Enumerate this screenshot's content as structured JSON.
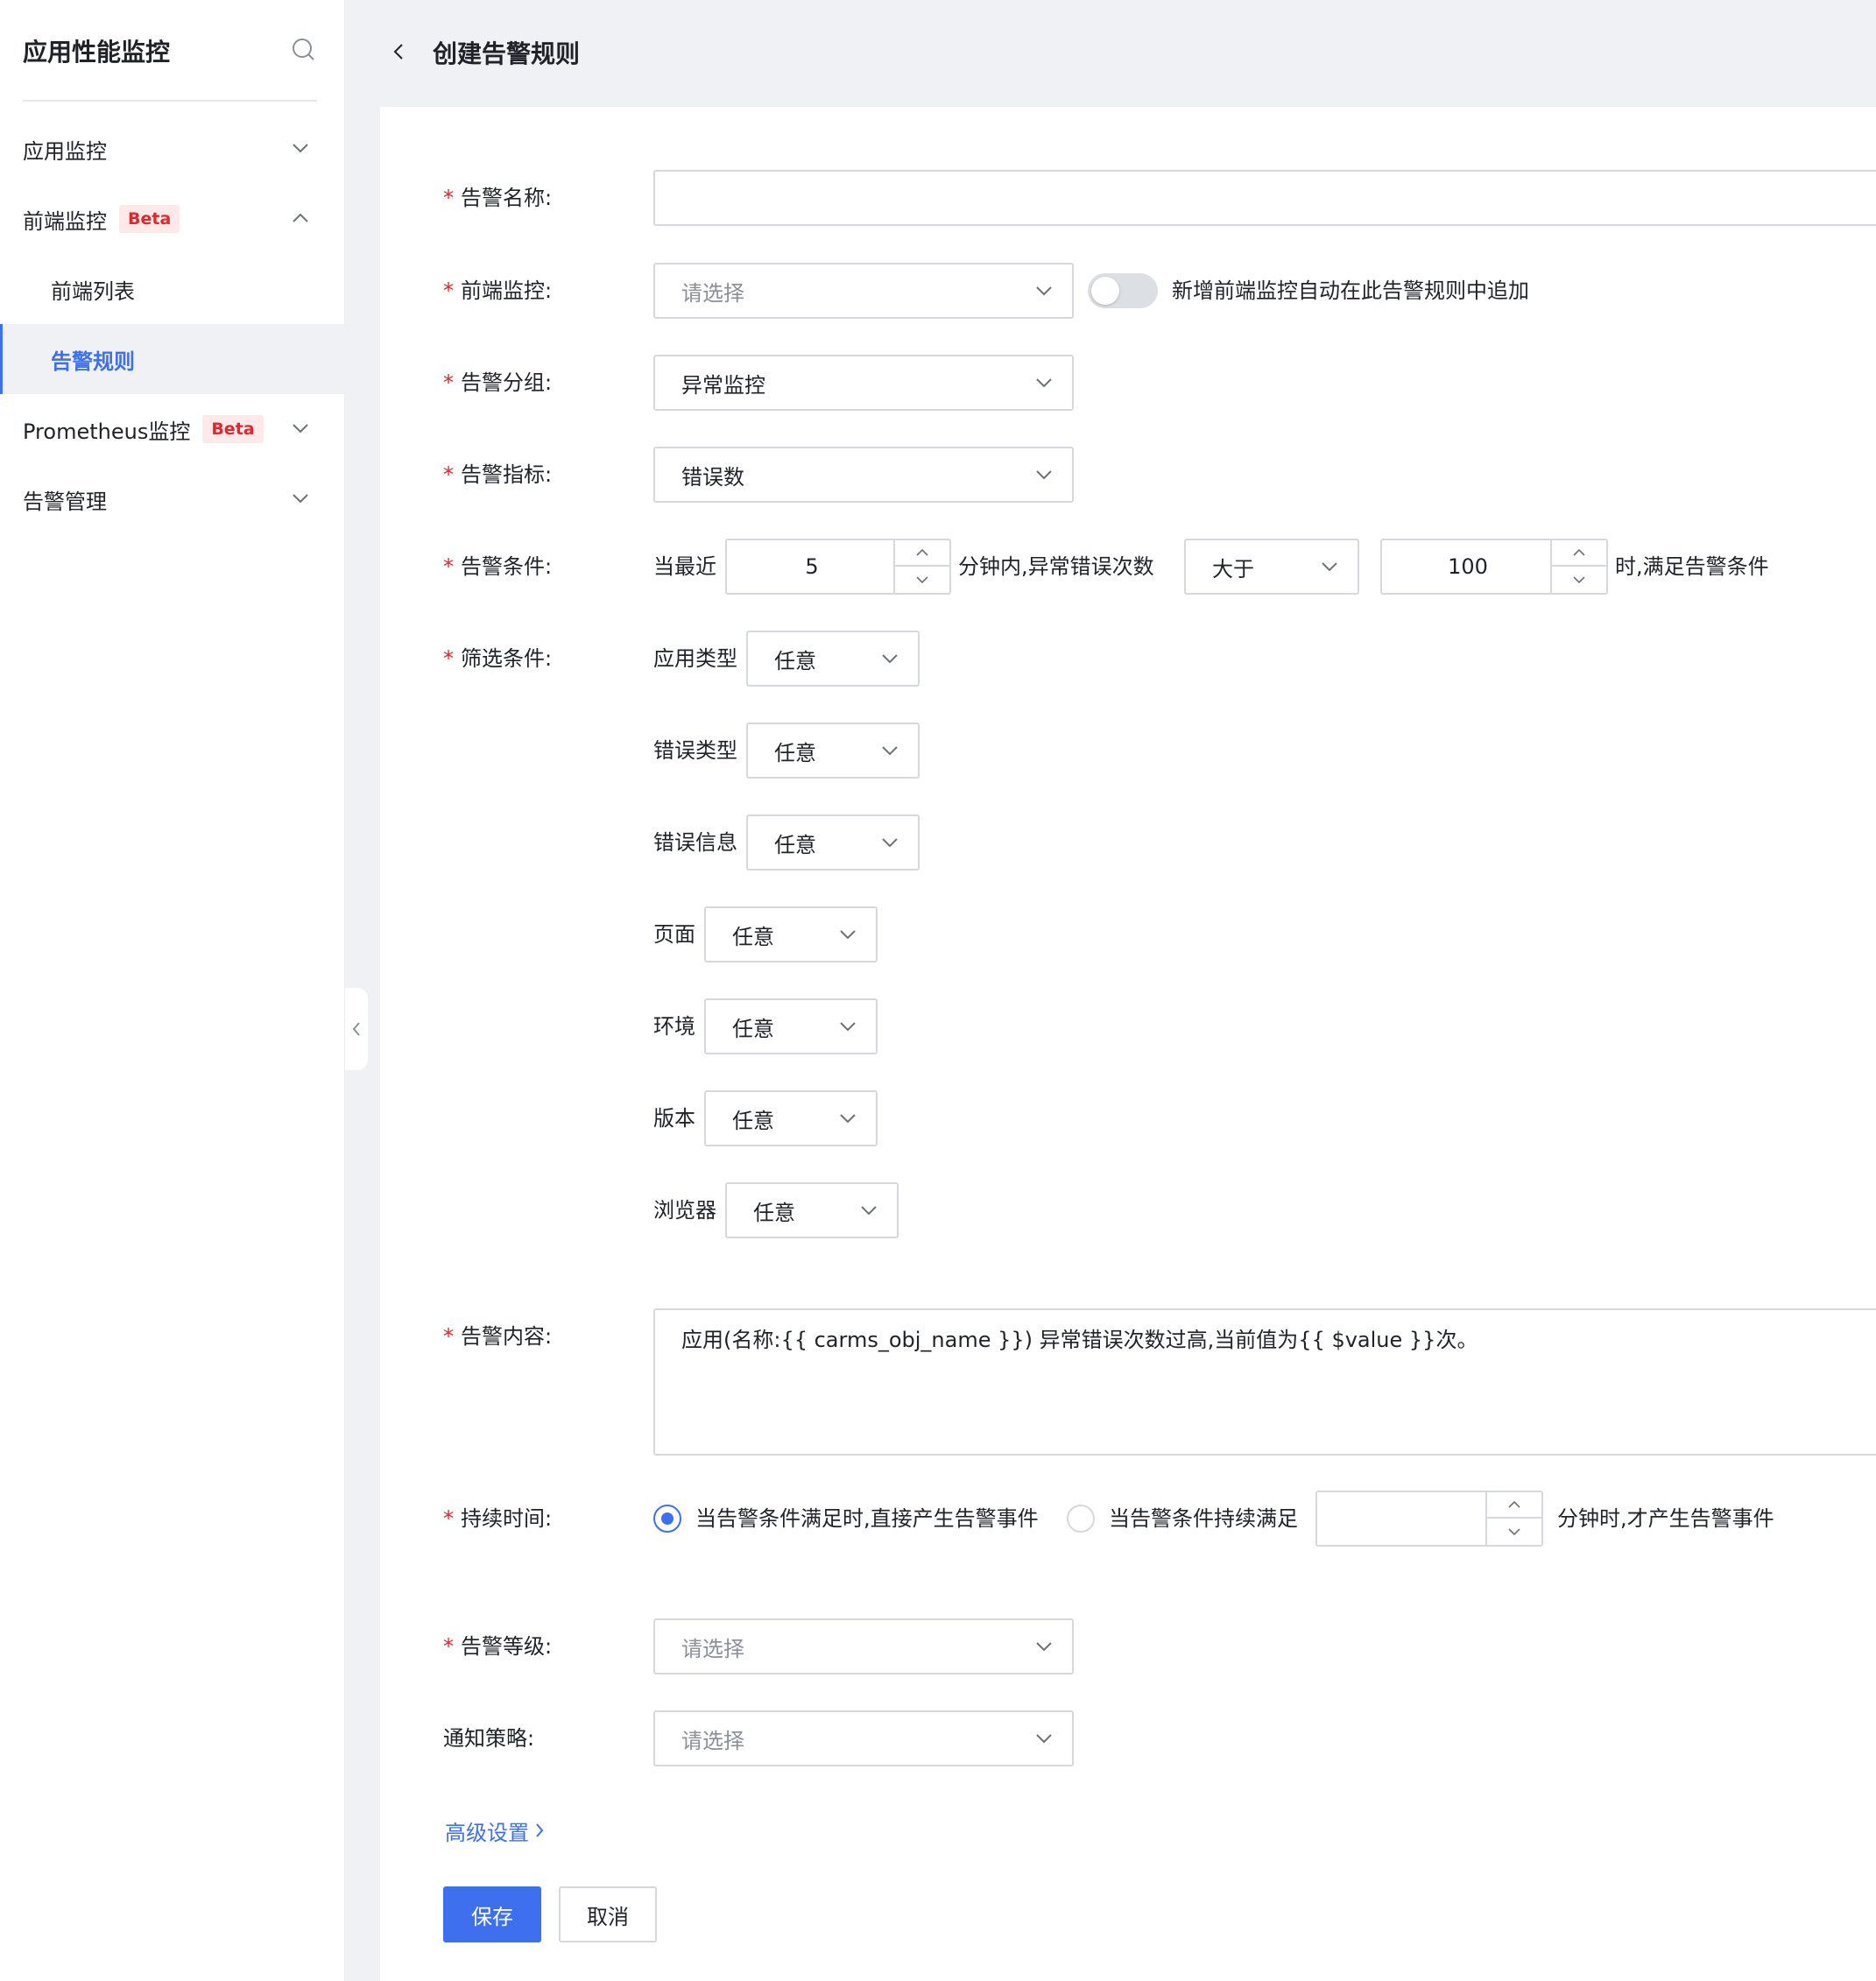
{
  "sidebar": {
    "title": "应用性能监控",
    "items": [
      {
        "label": "应用监控"
      },
      {
        "label": "前端监控",
        "badge": "Beta"
      },
      {
        "label": "前端列表"
      },
      {
        "label": "告警规则"
      },
      {
        "label": "Prometheus监控",
        "badge": "Beta"
      },
      {
        "label": "告警管理"
      }
    ]
  },
  "header": {
    "title": "创建告警规则"
  },
  "form": {
    "alert_name": {
      "label": "告警名称:",
      "value": ""
    },
    "frontend_monitor": {
      "label": "前端监控:",
      "placeholder": "请选择",
      "toggle_on": false,
      "toggle_label": "新增前端监控自动在此告警规则中追加"
    },
    "alert_group": {
      "label": "告警分组:",
      "value": "异常监控"
    },
    "alert_metric": {
      "label": "告警指标:",
      "value": "错误数"
    },
    "alert_condition": {
      "label": "告警条件:",
      "prefix": "当最近",
      "minutes": "5",
      "middle": "分钟内,异常错误次数",
      "operator": "大于",
      "threshold": "100",
      "suffix": "时,满足告警条件"
    },
    "filter": {
      "label": "筛选条件:",
      "rows": [
        {
          "label": "应用类型",
          "value": "任意"
        },
        {
          "label": "错误类型",
          "value": "任意"
        },
        {
          "label": "错误信息",
          "value": "任意"
        },
        {
          "label": "页面",
          "value": "任意"
        },
        {
          "label": "环境",
          "value": "任意"
        },
        {
          "label": "版本",
          "value": "任意"
        },
        {
          "label": "浏览器",
          "value": "任意"
        }
      ]
    },
    "alert_content": {
      "label": "告警内容:",
      "value": "应用(名称:{{ carms_obj_name }}) 异常错误次数过高,当前值为{{ $value }}次。"
    },
    "duration": {
      "label": "持续时间:",
      "option1": "当告警条件满足时,直接产生告警事件",
      "option2": "当告警条件持续满足",
      "minutes": "",
      "suffix": "分钟时,才产生告警事件",
      "selected": 1
    },
    "alert_level": {
      "label": "告警等级:",
      "placeholder": "请选择"
    },
    "notify_policy": {
      "label": "通知策略:",
      "placeholder": "请选择"
    },
    "advanced": "高级设置",
    "save": "保存",
    "cancel": "取消"
  },
  "colors": {
    "accent": "#3d6fef",
    "required": "#e5242b",
    "badge_bg": "#fde9ea"
  }
}
